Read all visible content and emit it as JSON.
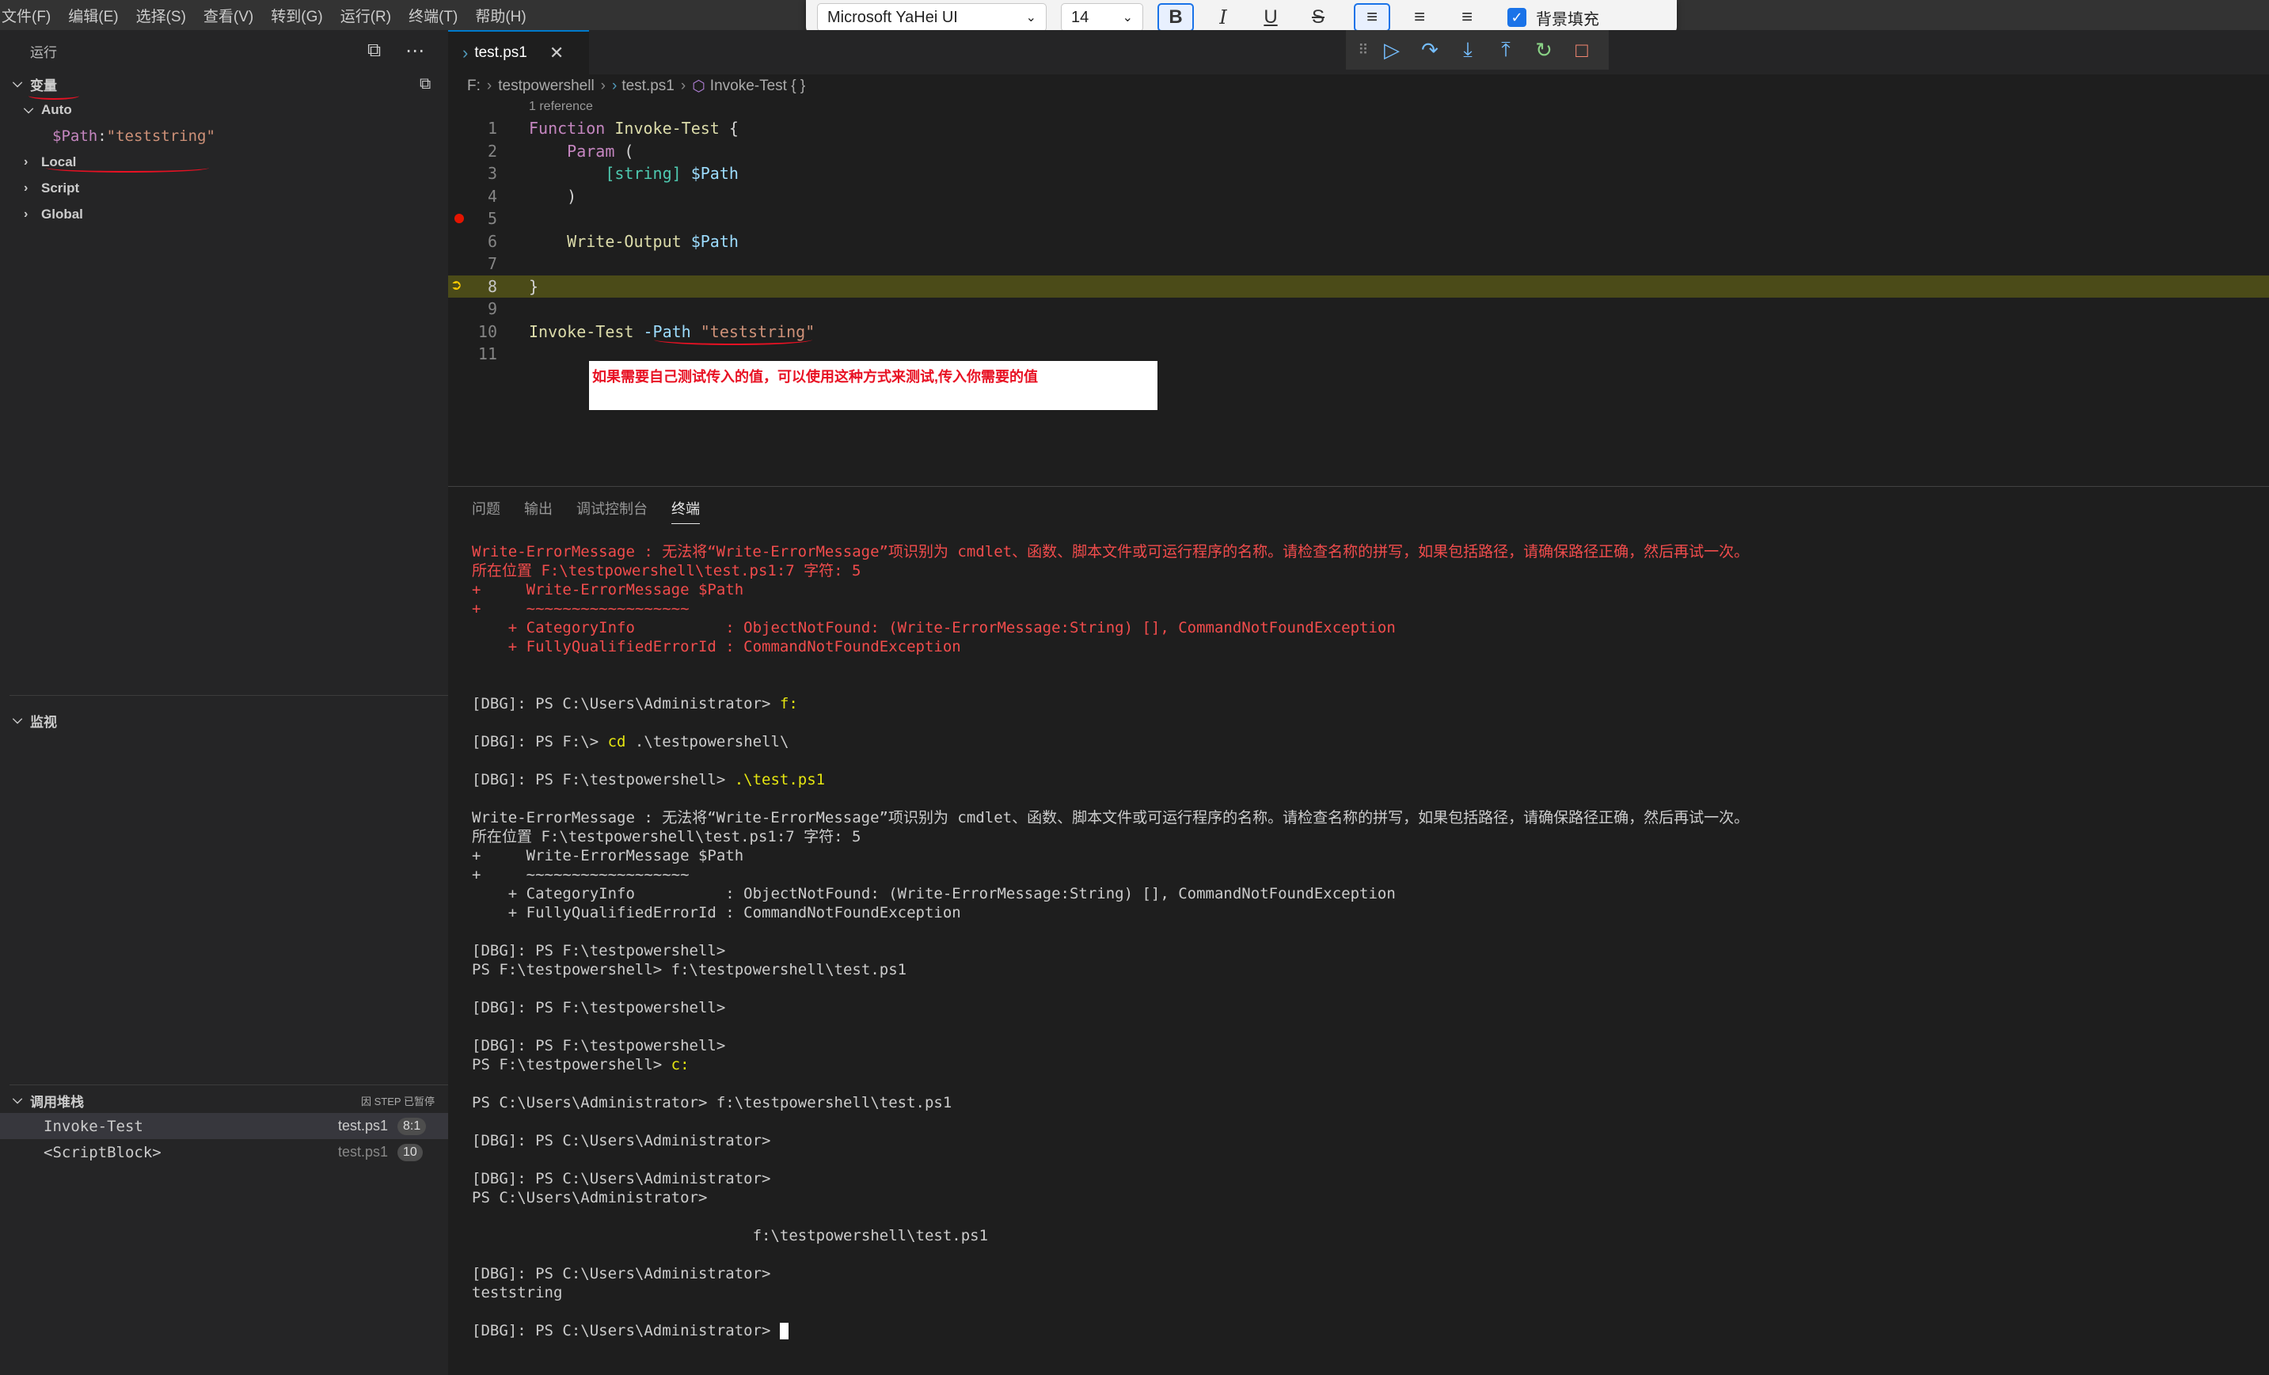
{
  "menu": [
    "文件(F)",
    "编辑(E)",
    "选择(S)",
    "查看(V)",
    "转到(G)",
    "运行(R)",
    "终端(T)",
    "帮助(H)"
  ],
  "format_toolbar": {
    "font_family": "Microsoft YaHei UI",
    "font_size": "14",
    "bold": "B",
    "italic": "I",
    "underline": "U",
    "strike": "S",
    "bg_fill_label": "背景填充"
  },
  "sidebar": {
    "run_title": "运行",
    "variables_title": "变量",
    "auto_label": "Auto",
    "auto_var_name": "$Path",
    "auto_var_sep": ": ",
    "auto_var_value": "\"teststring\"",
    "scopes": [
      "Local",
      "Script",
      "Global"
    ],
    "watch_title": "监视",
    "callstack_title": "调用堆栈",
    "callstack_status": "因 STEP 已暂停",
    "frames": [
      {
        "name": "Invoke-Test",
        "file": "test.ps1",
        "pos": "8:1"
      },
      {
        "name": "<ScriptBlock>",
        "file": "test.ps1",
        "pos": "10"
      }
    ]
  },
  "editor": {
    "tab_label": "test.ps1",
    "breadcrumb": [
      "F:",
      "testpowershell",
      "test.ps1",
      "Invoke-Test { }"
    ],
    "codelens": "1 reference",
    "annotation": "如果需要自己测试传入的值，可以使用这种方式来测试,传入你需要的值",
    "lines": [
      {
        "n": "1"
      },
      {
        "n": "2"
      },
      {
        "n": "3"
      },
      {
        "n": "4"
      },
      {
        "n": "5"
      },
      {
        "n": "6"
      },
      {
        "n": "7"
      },
      {
        "n": "8"
      },
      {
        "n": "9"
      },
      {
        "n": "10"
      },
      {
        "n": "11"
      }
    ],
    "code": {
      "l1_kw": "Function",
      "l1_fn": " Invoke-Test",
      "l1_rest": " {",
      "l2_kw": "    Param",
      "l2_rest": " (",
      "l3_type": "        [string]",
      "l3_var": " $Path",
      "l4": "    )",
      "l6_fn": "    Write-Output",
      "l6_var": " $Path",
      "l8": "}",
      "l10_fn": "Invoke-Test",
      "l10_param": " -Path",
      "l10_str": " \"teststring\""
    }
  },
  "panel": {
    "tabs": [
      "问题",
      "输出",
      "调试控制台",
      "终端"
    ],
    "active_tab": "终端",
    "terminal": [
      {
        "t": "Write-ErrorMessage : 无法将“Write-ErrorMessage”项识别为 cmdlet、函数、脚本文件或可运行程序的名称。请检查名称的拼写，如果包括路径，请确保路径正确，然后再试一次。",
        "c": "err"
      },
      {
        "t": "所在位置 F:\\testpowershell\\test.ps1:7 字符: 5",
        "c": "err"
      },
      {
        "t": "+     Write-ErrorMessage $Path",
        "c": "err"
      },
      {
        "t": "+     ~~~~~~~~~~~~~~~~~~",
        "c": "err"
      },
      {
        "t": "    + CategoryInfo          : ObjectNotFound: (Write-ErrorMessage:String) [], CommandNotFoundException",
        "c": "err"
      },
      {
        "t": "    + FullyQualifiedErrorId : CommandNotFoundException",
        "c": "err"
      },
      {
        "t": "",
        "c": "norm"
      },
      {
        "t": "",
        "c": "norm"
      },
      {
        "t": "[DBG]: PS C:\\Users\\Administrator> ",
        "c": "norm",
        "cmd": "f:"
      },
      {
        "t": "",
        "c": "norm"
      },
      {
        "t": "[DBG]: PS F:\\> ",
        "c": "norm",
        "cmd": "cd",
        "rest": " .\\testpowershell\\"
      },
      {
        "t": "",
        "c": "norm"
      },
      {
        "t": "[DBG]: PS F:\\testpowershell> ",
        "c": "norm",
        "cmd": ".\\test.ps1"
      },
      {
        "t": "",
        "c": "norm"
      },
      {
        "t": "Write-ErrorMessage : 无法将“Write-ErrorMessage”项识别为 cmdlet、函数、脚本文件或可运行程序的名称。请检查名称的拼写，如果包括路径，请确保路径正确，然后再试一次。",
        "c": "norm"
      },
      {
        "t": "所在位置 F:\\testpowershell\\test.ps1:7 字符: 5",
        "c": "norm"
      },
      {
        "t": "+     Write-ErrorMessage $Path",
        "c": "norm"
      },
      {
        "t": "+     ~~~~~~~~~~~~~~~~~~",
        "c": "norm"
      },
      {
        "t": "    + CategoryInfo          : ObjectNotFound: (Write-ErrorMessage:String) [], CommandNotFoundException",
        "c": "norm"
      },
      {
        "t": "    + FullyQualifiedErrorId : CommandNotFoundException",
        "c": "norm"
      },
      {
        "t": "",
        "c": "norm"
      },
      {
        "t": "[DBG]: PS F:\\testpowershell>",
        "c": "norm"
      },
      {
        "t": "PS F:\\testpowershell> f:\\testpowershell\\test.ps1",
        "c": "norm"
      },
      {
        "t": "",
        "c": "norm"
      },
      {
        "t": "[DBG]: PS F:\\testpowershell>",
        "c": "norm"
      },
      {
        "t": "",
        "c": "norm"
      },
      {
        "t": "[DBG]: PS F:\\testpowershell>",
        "c": "norm"
      },
      {
        "t": "PS F:\\testpowershell> ",
        "c": "norm",
        "cmd": "c:"
      },
      {
        "t": "",
        "c": "norm"
      },
      {
        "t": "PS C:\\Users\\Administrator> f:\\testpowershell\\test.ps1",
        "c": "norm"
      },
      {
        "t": "",
        "c": "norm"
      },
      {
        "t": "[DBG]: PS C:\\Users\\Administrator>",
        "c": "norm"
      },
      {
        "t": "",
        "c": "norm"
      },
      {
        "t": "[DBG]: PS C:\\Users\\Administrator>",
        "c": "norm"
      },
      {
        "t": "PS C:\\Users\\Administrator>",
        "c": "norm"
      },
      {
        "t": "",
        "c": "norm"
      },
      {
        "t": "                               f:\\testpowershell\\test.ps1",
        "c": "norm"
      },
      {
        "t": "",
        "c": "norm"
      },
      {
        "t": "[DBG]: PS C:\\Users\\Administrator>",
        "c": "norm"
      },
      {
        "t": "teststring",
        "c": "norm"
      },
      {
        "t": "",
        "c": "norm"
      },
      {
        "t": "[DBG]: PS C:\\Users\\Administrator> ",
        "c": "norm",
        "cursor": true
      }
    ]
  }
}
